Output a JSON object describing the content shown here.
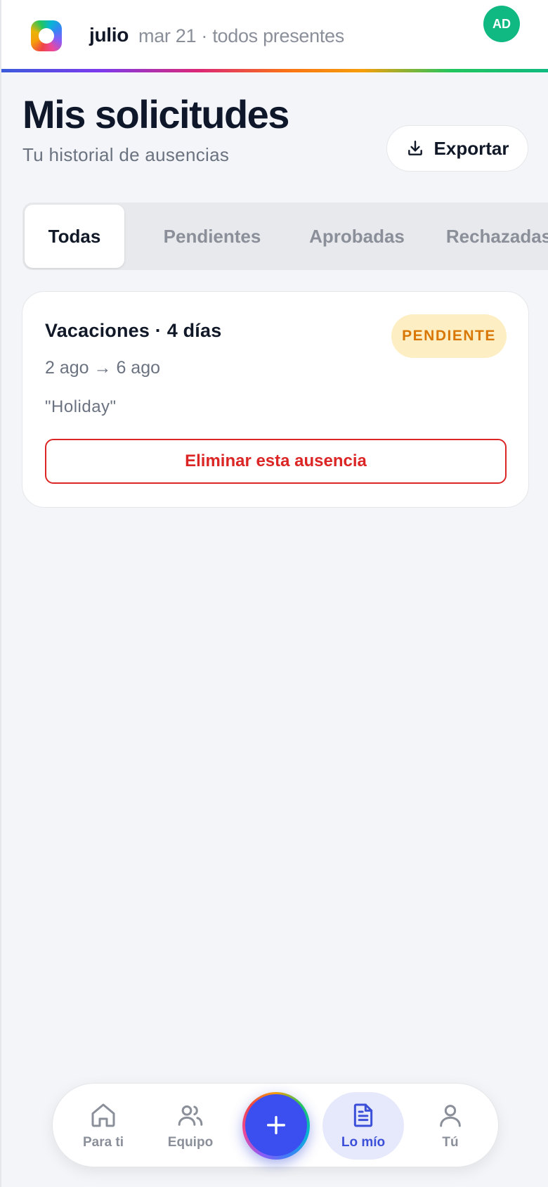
{
  "header": {
    "brand": "julio",
    "subinfo": "mar 21 · todos presentes",
    "avatar_initials": "AD",
    "avatar_color": "#10b981"
  },
  "page": {
    "title": "Mis solicitudes",
    "subtitle": "Tu historial de ausencias",
    "export_label": "Exportar"
  },
  "tabs": [
    {
      "label": "Todas",
      "active": true
    },
    {
      "label": "Pendientes",
      "active": false
    },
    {
      "label": "Aprobadas",
      "active": false
    },
    {
      "label": "Rechazadas",
      "active": false
    }
  ],
  "requests": [
    {
      "title": "Vacaciones · 4 días",
      "dates": "2 ago → 6 ago",
      "note": "\"Holiday\"",
      "status": "PENDIENTE",
      "status_color": "#d97706",
      "delete_label": "Eliminar esta ausencia"
    }
  ],
  "bottom_nav": {
    "items": [
      {
        "label": "Para ti",
        "icon": "home-icon",
        "active": false
      },
      {
        "label": "Equipo",
        "icon": "users-icon",
        "active": false
      },
      {
        "label": "Lo mío",
        "icon": "document-icon",
        "active": true
      },
      {
        "label": "Tú",
        "icon": "user-icon",
        "active": false
      }
    ],
    "fab_icon": "plus-icon"
  },
  "colors": {
    "accent": "#3b4fd8",
    "danger": "#dc2626",
    "pending_bg": "#fdefc3"
  }
}
